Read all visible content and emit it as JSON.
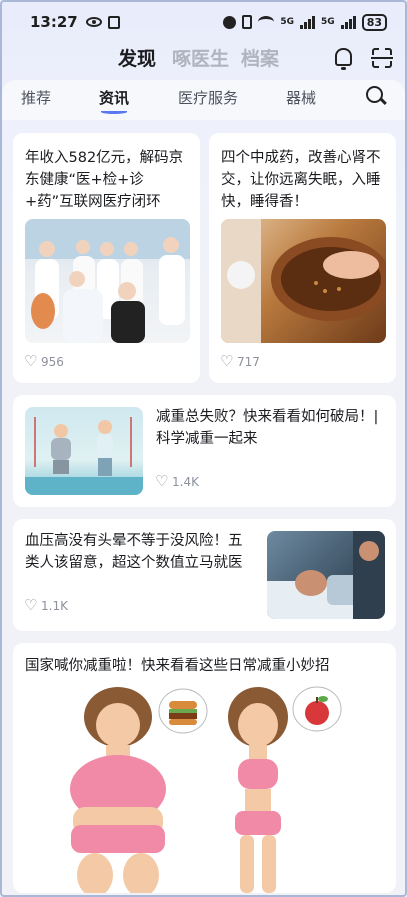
{
  "status": {
    "time": "13:27",
    "net1": "5G",
    "net2": "5G",
    "battery": "83"
  },
  "top_tabs": [
    "发现",
    "啄医生",
    "档案"
  ],
  "sub_tabs": [
    "推荐",
    "资讯",
    "医疗服务",
    "器械"
  ],
  "articles": [
    {
      "title": "年收入582亿元，解码京东健康“医+检+诊+药”互联网医疗闭环",
      "likes": "956"
    },
    {
      "title": "四个中成药，改善心肾不交，让你远离失眠，入睡快，睡得香！",
      "likes": "717"
    },
    {
      "title": "减重总失败？快来看看如何破局！| 科学减重一起来",
      "likes": "1.4K"
    },
    {
      "title": "血压高没有头晕不等于没风险！五类人该留意，超这个数值立马就医",
      "likes": "1.1K"
    },
    {
      "title": "国家喊你减重啦！快来看看这些日常减重小妙招"
    }
  ],
  "icons": {
    "status": [
      "eye-icon",
      "nfc-icon",
      "alarm-icon",
      "vibrate-icon",
      "wifi-icon",
      "signal-icon",
      "battery-icon"
    ],
    "header": [
      "bell-icon",
      "scan-icon"
    ],
    "search": "search-icon",
    "like": "heart-icon"
  },
  "colors": {
    "accent": "#5a78f0",
    "active_text": "#1b1c20",
    "inactive_text": "#b0b4bf"
  }
}
